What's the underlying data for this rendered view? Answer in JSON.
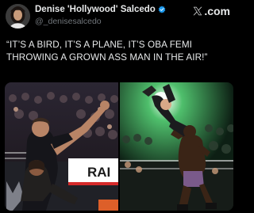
{
  "post": {
    "author": {
      "display_name": "Denise 'Hollywood' Salcedo",
      "handle": "@_denisesalcedo",
      "verified": true,
      "avatar_icon": "avatar-portrait"
    },
    "brand": {
      "logo_icon": "x-logo-icon",
      "label": ".com"
    },
    "text_line_1": "“IT’S A BIRD, IT’S A PLANE, IT’S OBA FEMI",
    "text_line_2": "THROWING A GROWN ASS MAN IN THE AIR!”",
    "media": [
      {
        "icon": "wrestling-photo-ringside",
        "sign_text": "RAI"
      },
      {
        "icon": "wrestling-photo-in-ring"
      }
    ]
  },
  "colors": {
    "background": "#000000",
    "text_primary": "#e7e9ea",
    "text_secondary": "#71767b",
    "verified_blue": "#1d9bf0"
  }
}
